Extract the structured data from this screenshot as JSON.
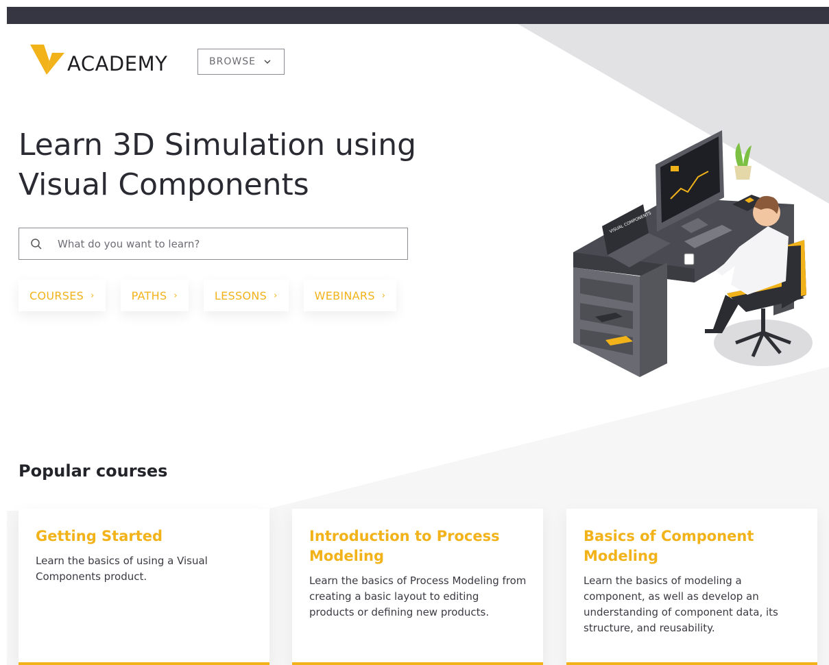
{
  "header": {
    "logo_text": "ACADEMY",
    "browse_label": "BROWSE"
  },
  "hero": {
    "title_line1": "Learn 3D Simulation using",
    "title_line2": "Visual Components",
    "search_placeholder": "What do you want to learn?",
    "quick_links": [
      {
        "label": "COURSES",
        "arrow": "›"
      },
      {
        "label": "PATHS",
        "arrow": "›"
      },
      {
        "label": "LESSONS",
        "arrow": "›"
      },
      {
        "label": "WEBINARS",
        "arrow": "›"
      }
    ],
    "laptop_brand_text": "VISUAL COMPONENTS"
  },
  "popular": {
    "title": "Popular courses",
    "cards": [
      {
        "title": "Getting Started",
        "description": "Learn the basics of using a Visual Components product."
      },
      {
        "title": "Introduction to Process Modeling",
        "description": "Learn the basics of Process Modeling from creating a basic layout to editing products or defining new products."
      },
      {
        "title": "Basics of Component Modeling",
        "description": "Learn the basics of modeling a component, as well as develop an understanding of component data, its structure, and reusability."
      }
    ]
  },
  "colors": {
    "accent": "#f2b21a",
    "topbar": "#353641",
    "text_dark": "#2a2a32"
  },
  "icons": [
    "logo-v-icon",
    "chevron-down-icon",
    "search-icon",
    "chevron-right-icon"
  ]
}
